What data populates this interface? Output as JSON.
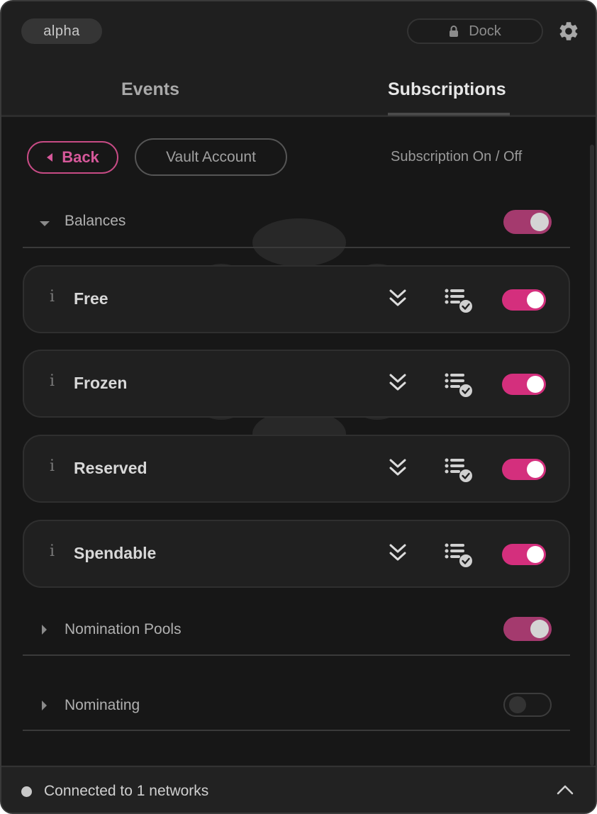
{
  "header": {
    "account_pill": "alpha",
    "dock_label": "Dock"
  },
  "tabs": [
    {
      "label": "Events",
      "active": false
    },
    {
      "label": "Subscriptions",
      "active": true
    }
  ],
  "toolbar": {
    "back_label": "Back",
    "vault_label": "Vault Account",
    "subscription_toggle_caption": "Subscription On / Off"
  },
  "sections": {
    "balances": {
      "label": "Balances",
      "expanded": true,
      "enabled": true
    },
    "nomination_pools": {
      "label": "Nomination Pools",
      "expanded": false,
      "enabled": true
    },
    "nominating": {
      "label": "Nominating",
      "expanded": false,
      "enabled": false
    }
  },
  "balance_items": [
    {
      "info": "i",
      "label": "Free",
      "enabled": true
    },
    {
      "info": "i",
      "label": "Frozen",
      "enabled": true
    },
    {
      "info": "i",
      "label": "Reserved",
      "enabled": true
    },
    {
      "info": "i",
      "label": "Spendable",
      "enabled": true
    }
  ],
  "footer": {
    "status_text": "Connected to 1 networks"
  },
  "icons": {
    "lock": "lock-icon",
    "gear": "gear-icon",
    "back_arrow": "caret-left-icon",
    "expand_section": "caret-down-icon",
    "collapsed_section": "caret-right-icon",
    "one_shot": "double-chevron-down-icon",
    "native_checkbox": "list-check-icon",
    "status_dot": "status-dot-icon",
    "footer_toggle": "chevron-up-icon"
  },
  "colors": {
    "accent": "#d42f7d",
    "accent_muted": "#a43a6e",
    "background": "#171717",
    "card": "#202020"
  }
}
